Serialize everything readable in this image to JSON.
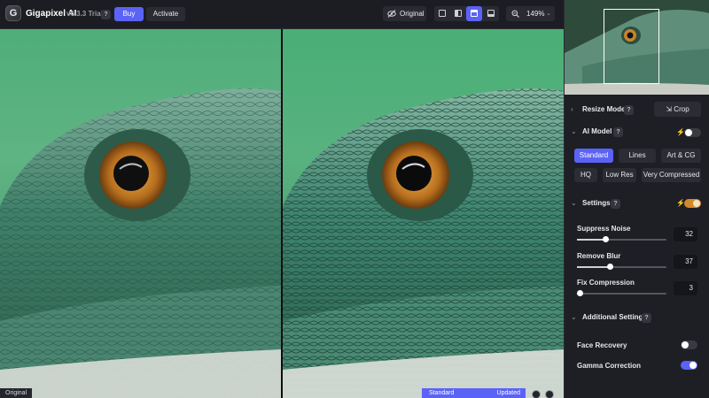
{
  "app": {
    "logo_letter": "G",
    "name": "Gigapixel AI",
    "version": "v6.3.3 Trial",
    "help": "?"
  },
  "toolbar": {
    "buy_label": "Buy",
    "activate_label": "Activate",
    "original_label": "Original",
    "view_modes": [
      "single-view",
      "split-view",
      "side-by-side-view",
      "comparison-view"
    ],
    "active_view": "side-by-side-view",
    "zoom": "149%",
    "zoom_chevron": "⌄"
  },
  "preview": {
    "left_badge": "Original",
    "model_name": "Standard",
    "model_status": "Updated"
  },
  "panel": {
    "resize_mode": {
      "label": "Resize Mode",
      "crop_label": "Crop",
      "crop_icon": "⇲"
    },
    "ai_model": {
      "label": "AI Model",
      "auto_enabled": false,
      "options_row1": [
        "Standard",
        "Lines",
        "Art & CG"
      ],
      "options_row2": [
        "HQ",
        "Low Res",
        "Very Compressed"
      ],
      "selected": "Standard"
    },
    "settings": {
      "label": "Settings",
      "auto_enabled": true,
      "sliders": [
        {
          "label": "Suppress Noise",
          "value": "32",
          "fraction": 0.32
        },
        {
          "label": "Remove Blur",
          "value": "37",
          "fraction": 0.37
        },
        {
          "label": "Fix Compression",
          "value": "3",
          "fraction": 0.03
        }
      ]
    },
    "additional": {
      "label": "Additional Settings",
      "face_recovery_label": "Face Recovery",
      "face_recovery_on": false,
      "gamma_label": "Gamma Correction",
      "gamma_on": true
    }
  },
  "colors": {
    "accent": "#5b63f6",
    "auto_orange": "#d08a2c",
    "panel_bg": "#1e1f24",
    "topbar_bg": "#1c1d22"
  }
}
